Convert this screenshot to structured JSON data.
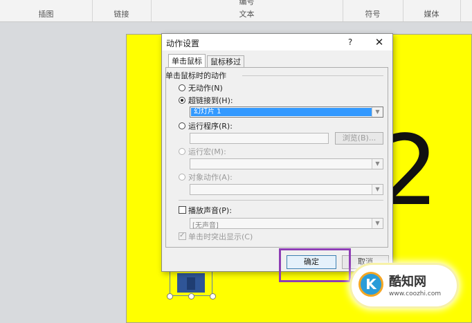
{
  "ribbon": {
    "groups": [
      {
        "label": "插图"
      },
      {
        "label": "链接"
      },
      {
        "label": "文本",
        "top_label": "编号"
      },
      {
        "label": "符号"
      },
      {
        "label": "媒体"
      }
    ]
  },
  "slide": {
    "digit": "2"
  },
  "dialog": {
    "title": "动作设置",
    "help": "?",
    "close": "✕",
    "tabs": [
      "单击鼠标",
      "鼠标移过"
    ],
    "section_heading": "单击鼠标时的动作",
    "options": {
      "no_action": "无动作(N)",
      "hyperlink": "超链接到(H):",
      "hyperlink_value": "幻灯片 1",
      "run_program": "运行程序(R):",
      "browse": "浏览(B)...",
      "run_macro": "运行宏(M):",
      "object_action": "对象动作(A):"
    },
    "play_sound": "播放声音(P):",
    "sound_value": "[无声音]",
    "highlight_click": "单击时突出显示(C)",
    "ok": "确定",
    "cancel": "取消"
  },
  "watermark": {
    "logo": "K",
    "name": "酷知网",
    "url": "www.coozhi.com"
  },
  "colors": {
    "slide": "#ffff00",
    "selection": "#3399ff",
    "highlight_box": "#8e3db5"
  }
}
